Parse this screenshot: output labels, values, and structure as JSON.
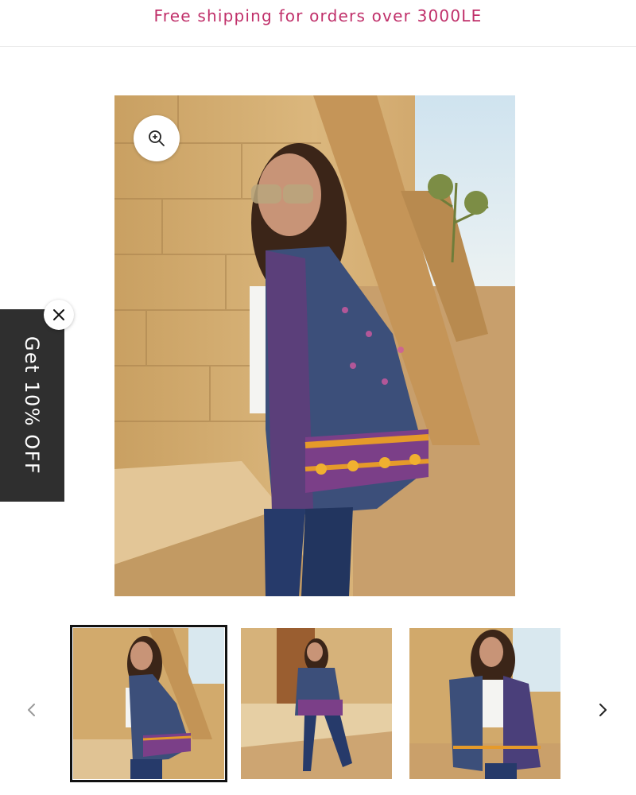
{
  "announcement": {
    "text": "Free shipping for orders over 3000LE"
  },
  "gallery": {
    "zoom_icon": "zoom-in-icon",
    "main_image_alt": "Woman wearing a patterned embroidered kimono jacket leaning on a stone wall",
    "thumbnails": [
      {
        "alt": "Kimono jacket side view against stone wall",
        "active": true
      },
      {
        "alt": "Kimono jacket seated by wooden door",
        "active": false
      },
      {
        "alt": "Kimono jacket front view",
        "active": false
      }
    ],
    "prev_icon": "chevron-left-icon",
    "next_icon": "chevron-right-icon"
  },
  "promo": {
    "label": "Get 10% OFF",
    "close_icon": "close-icon"
  },
  "colors": {
    "announcement_text": "#c0306a",
    "promo_background": "#2f2f2f",
    "active_thumb_border": "#121212"
  }
}
